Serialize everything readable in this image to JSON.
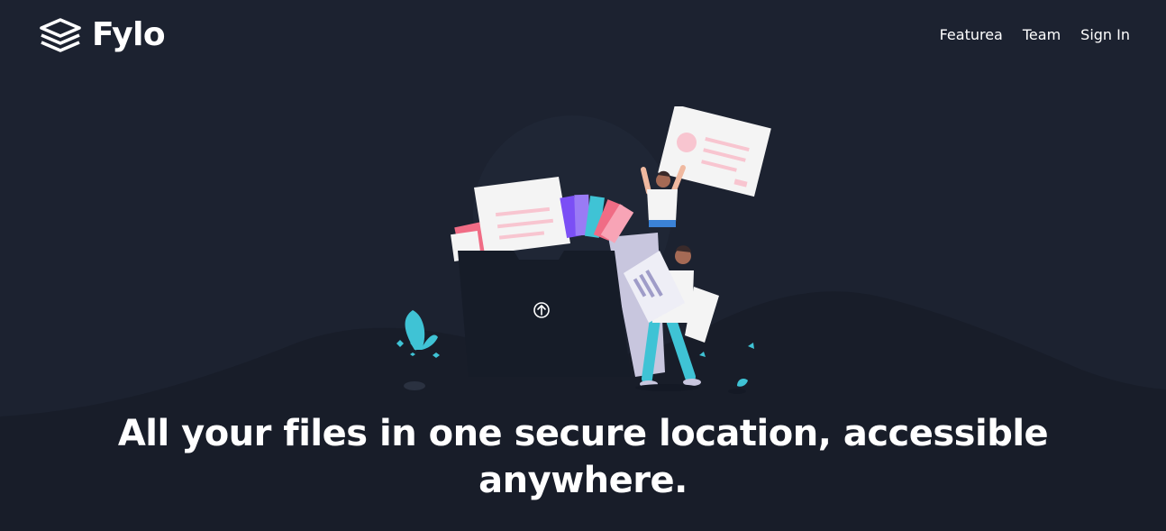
{
  "brand": {
    "name": "Fylo",
    "logo_icon": "stacked-layers-icon"
  },
  "nav": {
    "items": [
      {
        "label": "Featurea"
      },
      {
        "label": "Team"
      },
      {
        "label": "Sign In"
      }
    ]
  },
  "hero": {
    "illustration": "people-uploading-files-illustration",
    "upload_icon": "arrow-up-circle-icon",
    "headline_line1": "All your files in one secure location, accessible",
    "headline_line2": "anywhere."
  },
  "colors": {
    "background": "#1c2230",
    "background_wave": "#181d29",
    "text": "#ffffff",
    "accent_cyan": "#3fc3d5",
    "accent_pink": "#f06c85",
    "accent_purple": "#7b4ff5"
  }
}
